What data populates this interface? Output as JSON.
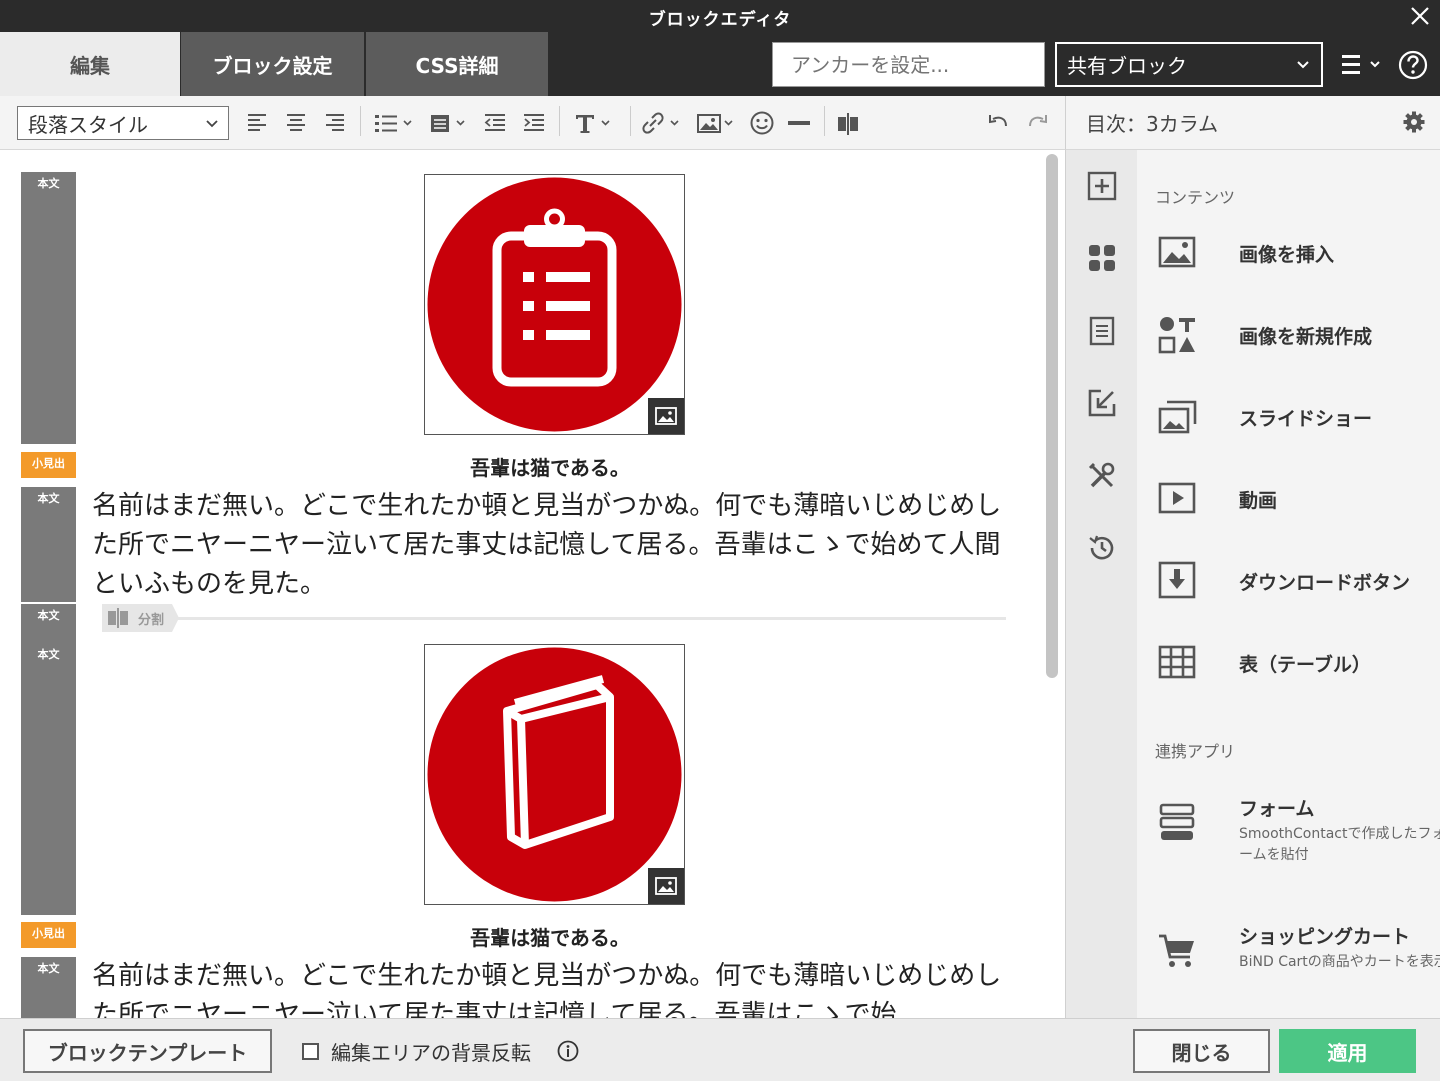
{
  "window": {
    "title": "ブロックエディタ"
  },
  "tabs": [
    {
      "label": "編集"
    },
    {
      "label": "ブロック設定"
    },
    {
      "label": "CSS詳細"
    }
  ],
  "anchor": {
    "placeholder": "アンカーを設定..."
  },
  "shared_block": {
    "selected": "共有ブロック"
  },
  "toolbar": {
    "paragraph_style": "段落スタイル"
  },
  "toc": {
    "label": "目次：3カラム"
  },
  "editor": {
    "tags": {
      "body": "本文",
      "heading": "小見出"
    },
    "blocks": [
      {
        "caption": "吾輩は猫である。",
        "text": "名前はまだ無い。どこで生れたか頓と見当がつかぬ。何でも薄暗いじめじめした所でニヤーニヤー泣いて居た事丈は記憶して居る。吾輩はこゝで始めて人間といふものを見た。",
        "image_icon": "clipboard-list-icon"
      },
      {
        "caption": "吾輩は猫である。",
        "text": "名前はまだ無い。どこで生れたか頓と見当がつかぬ。何でも薄暗いじめじめした所でニヤーニヤー泣いて居た事丈は記憶して居る。吾輩はこゝで始",
        "image_icon": "book-icon"
      }
    ],
    "split_label": "分割"
  },
  "panel": {
    "contents_label": "コンテンツ",
    "items": [
      {
        "label": "画像を挿入",
        "icon": "image-icon"
      },
      {
        "label": "画像を新規作成",
        "icon": "shapes-icon"
      },
      {
        "label": "スライドショー",
        "icon": "slideshow-icon"
      },
      {
        "label": "動画",
        "icon": "video-icon"
      },
      {
        "label": "ダウンロードボタン",
        "icon": "download-icon"
      },
      {
        "label": "表（テーブル）",
        "icon": "table-icon"
      }
    ],
    "apps_label": "連携アプリ",
    "apps": [
      {
        "label": "フォーム",
        "desc": "SmoothContactで作成したフォームを貼付",
        "icon": "form-icon"
      },
      {
        "label": "ショッピングカート",
        "desc": "BiND Cartの商品やカートを表示",
        "icon": "cart-icon"
      }
    ]
  },
  "footer": {
    "template_button": "ブロックテンプレート",
    "bg_invert_label": "編集エリアの背景反転",
    "close_button": "閉じる",
    "apply_button": "適用"
  },
  "colors": {
    "accent_red": "#c8000a",
    "apply_green": "#4cc685",
    "heading_tag": "#f39a2a"
  }
}
